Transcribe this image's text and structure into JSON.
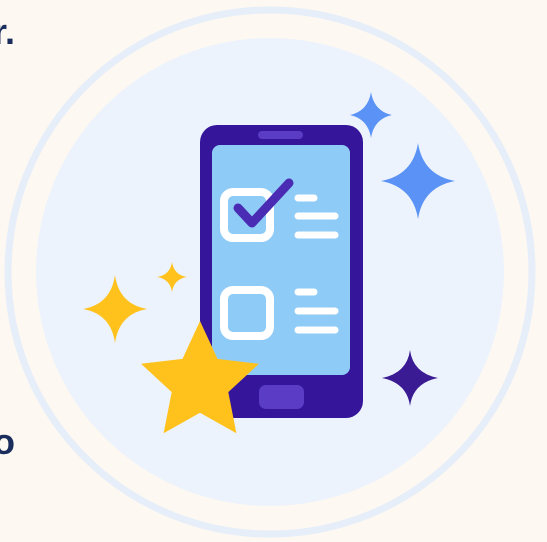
{
  "content": {
    "top_fragment": "r.",
    "bottom_fragment": "o"
  },
  "illustration": {
    "subject": "mobile-checklist-with-stars",
    "checklist_items": [
      {
        "checked": true
      },
      {
        "checked": false
      }
    ],
    "colors": {
      "page_background": "#fdf8f1",
      "text": "#1b2d5c",
      "circle_ring": "#e6eef9",
      "circle_fill": "#edf3fc",
      "phone_body": "#35159a",
      "phone_screen": "#8ecbf7",
      "check_box_border": "#ffffff",
      "check_mark": "#4a2bb3",
      "phone_button": "#5b3cc4",
      "star": "#ffc21d",
      "sparkle_yellow": "#ffc21d",
      "sparkle_blue": "#5b92f5",
      "sparkle_purple": "#3a1b94"
    }
  }
}
